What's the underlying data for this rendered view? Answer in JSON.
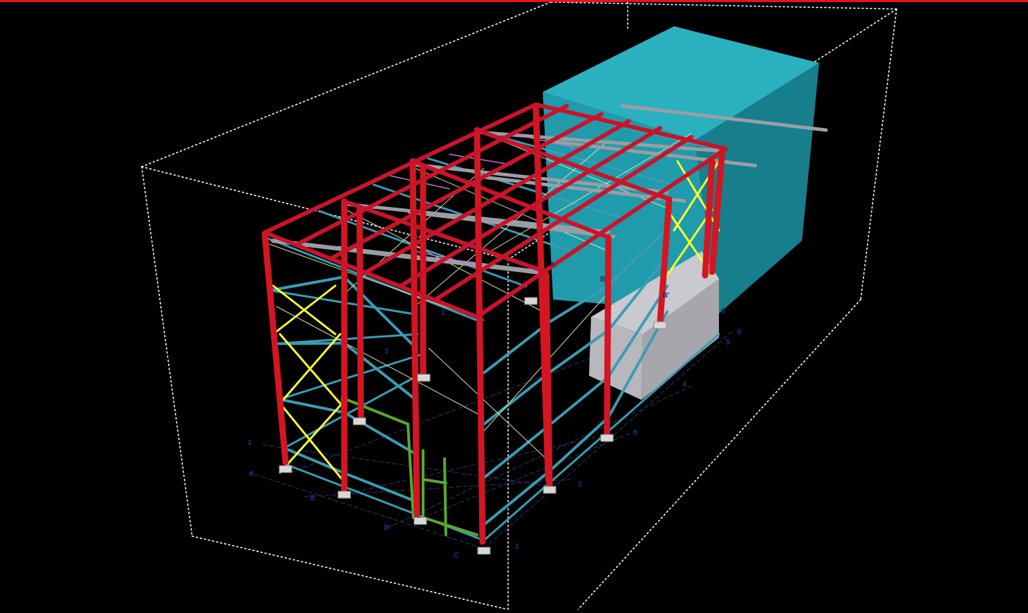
{
  "viewport": {
    "background": "#000000",
    "accent_bar_color": "#e8141b"
  },
  "colors": {
    "columns": "#d31622",
    "rafters": "#c8142a",
    "girts": "#3a9cb4",
    "bracing": "#ffff33",
    "bracing_light": "#e6e6a0",
    "door_frame": "#58a82e",
    "purlins": "#9a9ea4",
    "adjacent_building": "#1f9bab",
    "lean_to_walls": "#a6a6ac",
    "bounding_box": "#ffffff",
    "grid_lines": "#2a3a6a",
    "grid_labels": "#1a2f7a"
  },
  "grid_labels": {
    "front_axis": [
      "1",
      "A",
      "B",
      "B'",
      "C",
      "1"
    ],
    "side_axis": [
      "2",
      "3",
      "4",
      "5",
      "6",
      "6"
    ],
    "roof_axis": [
      "3",
      "2"
    ],
    "back_axis": [
      "A",
      "B",
      "B'"
    ]
  },
  "model": {
    "objects": [
      "steel-frame",
      "adjacent-building",
      "lean-to-annex",
      "bounding-box"
    ]
  }
}
